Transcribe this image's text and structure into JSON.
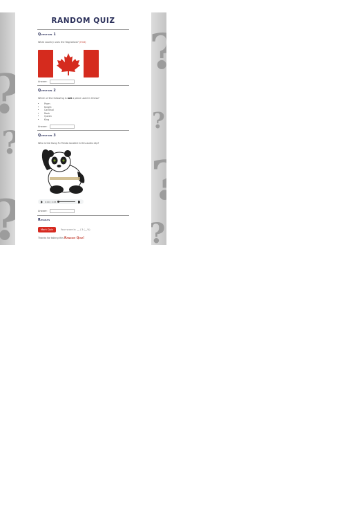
{
  "page": {
    "title": "RANDOM QUIZ",
    "background_color": "#f2f2f2",
    "accent_color": "#d62a20",
    "heading_color": "#2a2f5a"
  },
  "questions": [
    {
      "heading": "Question 1",
      "text": "What country uses the flag below?",
      "hint": "(Hint)",
      "image": "canada-flag",
      "answer_label": "Answer:"
    },
    {
      "heading": "Question 2",
      "text_before": "Which of the following is ",
      "text_bold": "not",
      "text_after": " a piece used in Chess?",
      "options": [
        "Pawn",
        "Knight",
        "Cardinal",
        "Rook",
        "Queen",
        "King"
      ],
      "answer_label": "Answer:"
    },
    {
      "heading": "Question 3",
      "text": "Who is the Kung Fu Panda located in this audio clip?",
      "image": "panda-character",
      "audio": {
        "time": "0:00 / 0:05"
      },
      "answer_label": "Answer:"
    }
  ],
  "results": {
    "heading": "Results",
    "button_label": "Mark Quiz",
    "score_text": "Your score is: __ / 3 (__%)"
  },
  "footer": {
    "thanks_text": "Thanks for taking this ",
    "brand": "Random Quiz!"
  }
}
